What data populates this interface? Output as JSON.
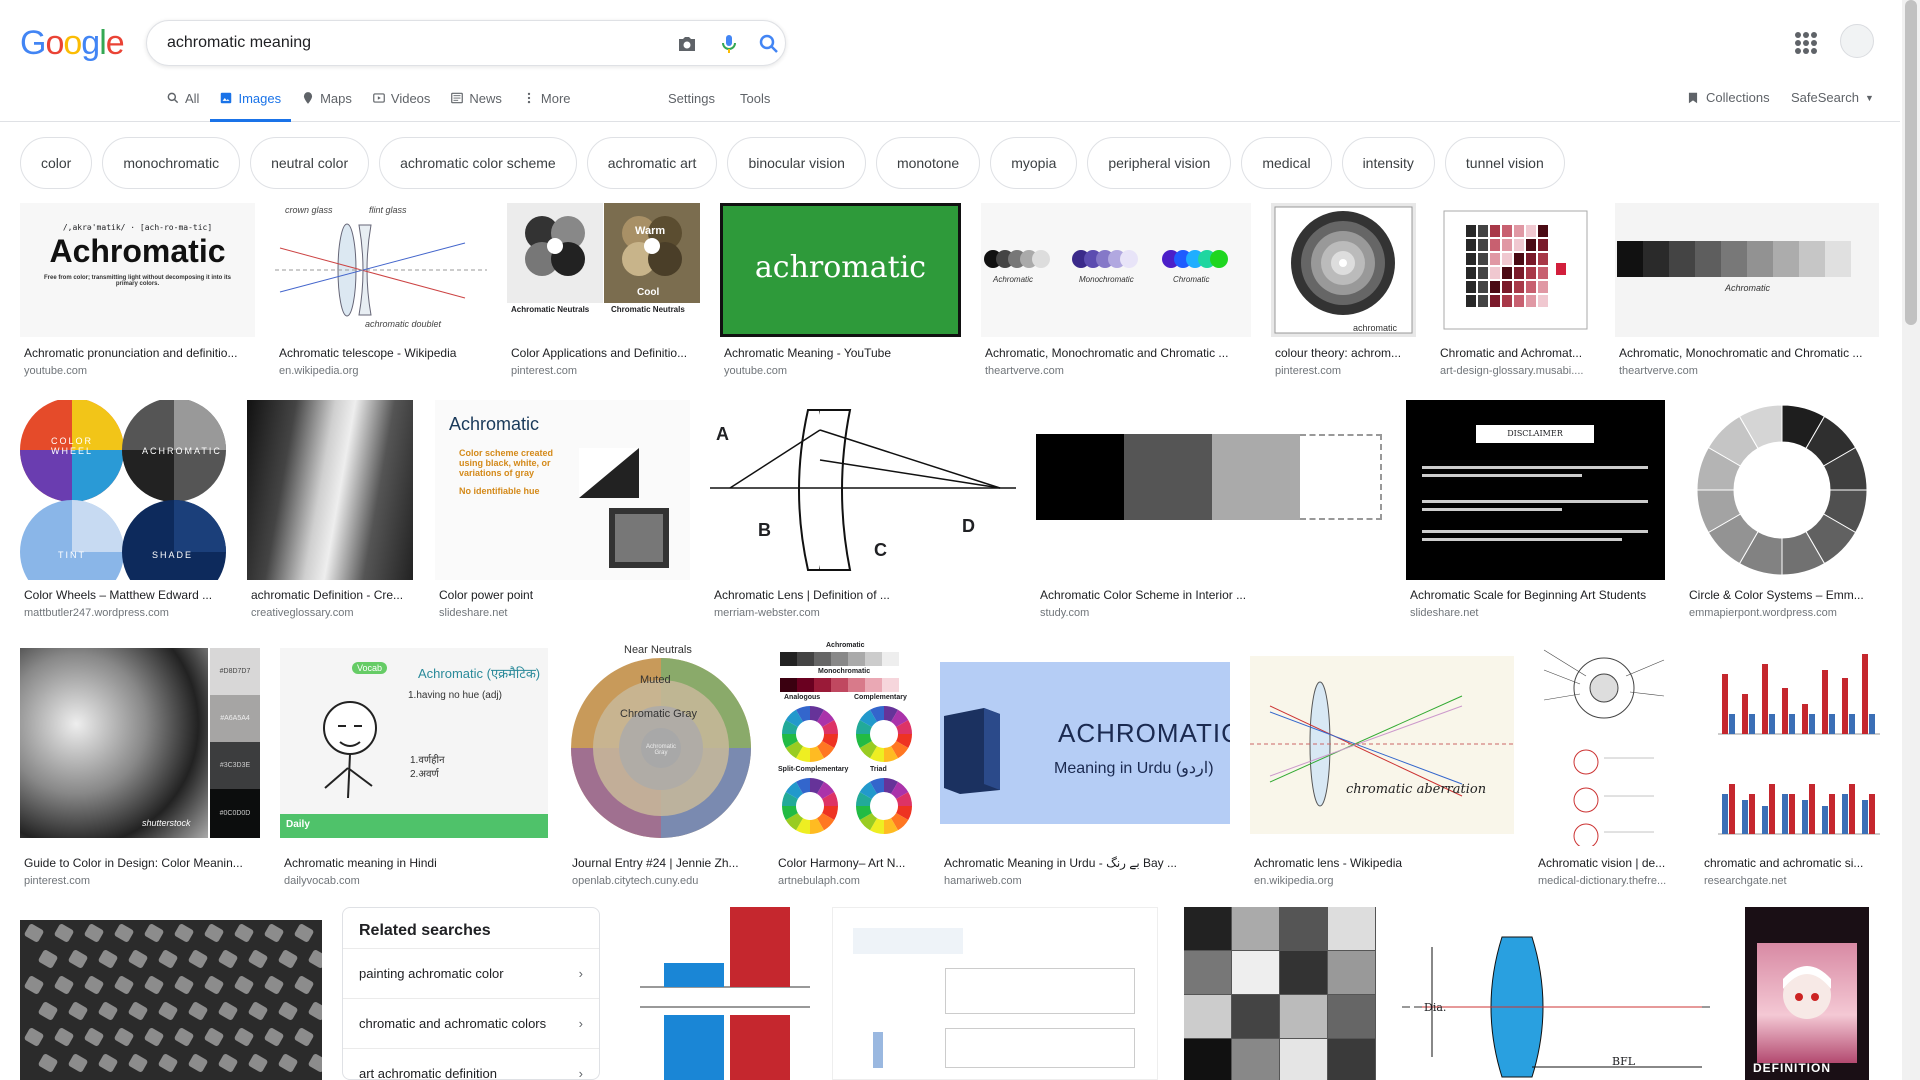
{
  "search": {
    "query": "achromatic meaning"
  },
  "logo_text": [
    "G",
    "o",
    "o",
    "g",
    "l",
    "e"
  ],
  "tabs": [
    {
      "label": "All",
      "icon": "search-icon"
    },
    {
      "label": "Images",
      "icon": "image-icon"
    },
    {
      "label": "Maps",
      "icon": "map-icon"
    },
    {
      "label": "Videos",
      "icon": "video-icon"
    },
    {
      "label": "News",
      "icon": "news-icon"
    },
    {
      "label": "More",
      "icon": "more-icon"
    }
  ],
  "settings_label": "Settings",
  "tools_label": "Tools",
  "collections_label": "Collections",
  "safesearch_label": "SafeSearch",
  "chips": [
    "color",
    "monochromatic",
    "neutral color",
    "achromatic color scheme",
    "achromatic art",
    "binocular vision",
    "monotone",
    "myopia",
    "peripheral vision",
    "medical",
    "intensity",
    "tunnel vision"
  ],
  "results": [
    {
      "title": "Achromatic pronunciation and definitio...",
      "source": "youtube.com"
    },
    {
      "title": "Achromatic telescope - Wikipedia",
      "source": "en.wikipedia.org"
    },
    {
      "title": "Color Applications and Definitio...",
      "source": "pinterest.com"
    },
    {
      "title": "Achromatic Meaning - YouTube",
      "source": "youtube.com"
    },
    {
      "title": "Achromatic, Monochromatic and Chromatic ...",
      "source": "theartverve.com"
    },
    {
      "title": "colour theory: achrom...",
      "source": "pinterest.com"
    },
    {
      "title": "Chromatic and Achromat...",
      "source": "art-design-glossary.musabi...."
    },
    {
      "title": "Achromatic, Monochromatic and Chromatic ...",
      "source": "theartverve.com"
    },
    {
      "title": "Color Wheels – Matthew Edward ...",
      "source": "mattbutler247.wordpress.com"
    },
    {
      "title": "achromatic Definition - Cre...",
      "source": "creativeglossary.com"
    },
    {
      "title": "Color power point",
      "source": "slideshare.net"
    },
    {
      "title": "Achromatic Lens | Definition of ...",
      "source": "merriam-webster.com"
    },
    {
      "title": "Achromatic Color Scheme in Interior ...",
      "source": "study.com"
    },
    {
      "title": "Achromatic Scale for Beginning Art Students",
      "source": "slideshare.net"
    },
    {
      "title": "Circle & Color Systems – Emm...",
      "source": "emmapierpont.wordpress.com"
    },
    {
      "title": "Guide to Color in Design: Color Meanin...",
      "source": "pinterest.com"
    },
    {
      "title": "Achromatic meaning in Hindi",
      "source": "dailyvocab.com"
    },
    {
      "title": "Journal Entry #24 | Jennie Zh...",
      "source": "openlab.citytech.cuny.edu"
    },
    {
      "title": "Color Harmony– Art N...",
      "source": "artnebulaph.com"
    },
    {
      "title": "Achromatic Meaning in Urdu - بے رنگ Bay ...",
      "source": "hamariweb.com"
    },
    {
      "title": "Achromatic lens - Wikipedia",
      "source": "en.wikipedia.org"
    },
    {
      "title": "Achromatic vision | de...",
      "source": "medical-dictionary.thefre..."
    },
    {
      "title": "chromatic and achromatic si...",
      "source": "researchgate.net"
    }
  ],
  "thumb_text": {
    "t1_big": "Achromatic",
    "t1_phon": "/,akrə'matik/ · [ach-ro-ma-tic]",
    "t1_def": "Free from color; transmitting light without decomposing it into its primary colors.",
    "t2_crown": "crown glass",
    "t2_flint": "flint glass",
    "t2_doublet": "achromatic doublet",
    "t3_warm": "Warm",
    "t3_cool": "Cool",
    "t3_an": "Achromatic Neutrals",
    "t3_cn": "Chromatic Neutrals",
    "t4": "achromatic",
    "t5a": "Achromatic",
    "t5b": "Monochromatic",
    "t5c": "Chromatic",
    "t6": "achromatic",
    "t8": "Achromatic",
    "t9a": "COLOR WHEEL",
    "t9b": "ACHROMATIC",
    "t9c": "TINT",
    "t9d": "SHADE",
    "t11_title": "Achromatic",
    "t11_b1": "Color scheme created using black, white, or variations of gray",
    "t11_b2": "No identifiable hue",
    "t12a": "A",
    "t12b": "B",
    "t12c": "C",
    "t12d": "D",
    "t14": "DISCLAIMER",
    "t16_vocab": "Vocab",
    "t17_title": "Achromatic (एक्रमैटिक)",
    "t17_def": "1.having no hue (adj)",
    "t17_h1": "1.वर्णहीन",
    "t17_h2": "2.अवर्ण",
    "t17_foot": "Daily",
    "t18_a": "Near Neutrals",
    "t18_b": "Muted",
    "t18_c": "Chromatic Gray",
    "t18_d": "Achromatic Gray",
    "t19_a": "Achromatic",
    "t19_b": "Monochromatic",
    "t19_c": "Analogous",
    "t19_d": "Complementary",
    "t19_e": "Split-Complementary",
    "t19_f": "Triad",
    "t20_a": "ACHROMATIC",
    "t20_b": "Meaning in Urdu (اردو)",
    "t21": "chromatic aberration",
    "t16_hex": [
      "#D8D7D7",
      "#A6A5A4",
      "#3C3D3E",
      "#0C0D0D"
    ],
    "t16_wm": "shutterstock",
    "tdef": "DEFINITION",
    "tdia": "Dia.",
    "tbfl": "BFL"
  },
  "related": {
    "title": "Related searches",
    "items": [
      "painting achromatic color",
      "chromatic and achromatic colors",
      "art achromatic definition"
    ]
  }
}
